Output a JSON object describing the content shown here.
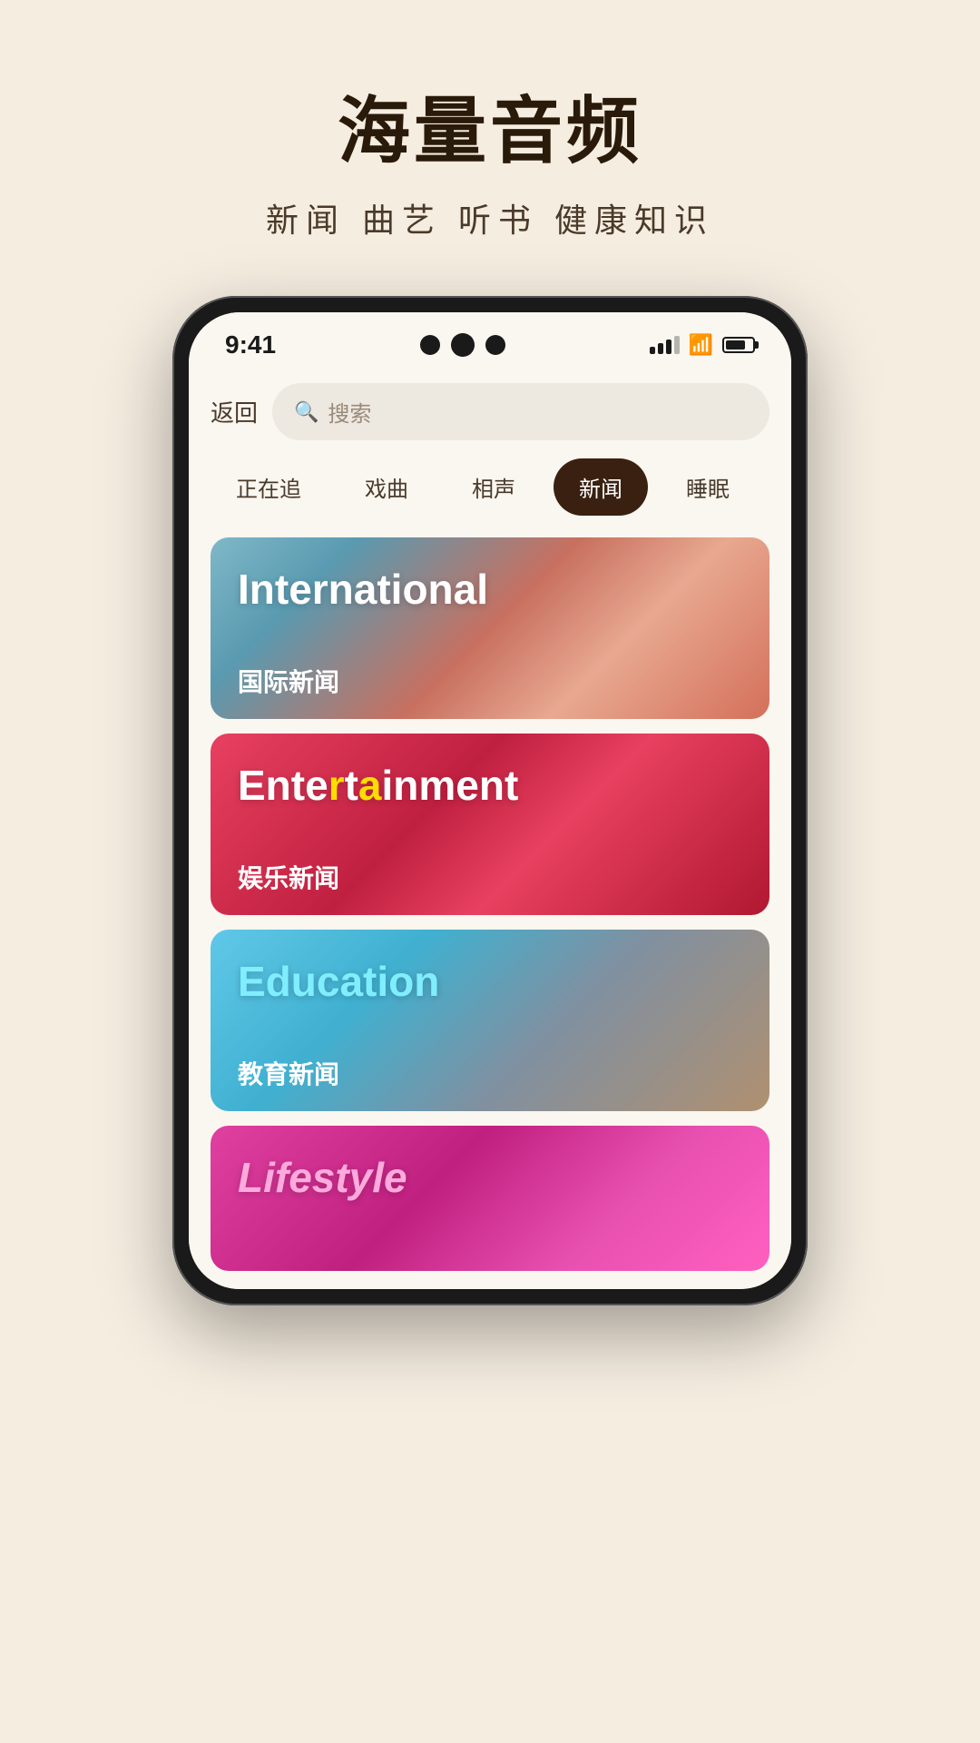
{
  "page": {
    "background_color": "#f5ede0",
    "title": "海量音频",
    "subtitle": "新闻 曲艺 听书 健康知识"
  },
  "status_bar": {
    "time": "9:41",
    "signal_strength": 3,
    "wifi": true,
    "battery_percent": 75
  },
  "nav": {
    "back_label": "返回",
    "search_placeholder": "搜索"
  },
  "tabs": [
    {
      "id": "following",
      "label": "正在追",
      "active": false
    },
    {
      "id": "opera",
      "label": "戏曲",
      "active": false
    },
    {
      "id": "crosstalk",
      "label": "相声",
      "active": false
    },
    {
      "id": "news",
      "label": "新闻",
      "active": true
    },
    {
      "id": "sleep",
      "label": "睡眠",
      "active": false
    }
  ],
  "cards": [
    {
      "id": "international",
      "title_en": "International",
      "title_cn": "国际新闻",
      "gradient_class": "card-international"
    },
    {
      "id": "entertainment",
      "title_en": "Entertainment",
      "title_cn": "娱乐新闻",
      "gradient_class": "card-entertainment"
    },
    {
      "id": "education",
      "title_en": "Education",
      "title_cn": "教育新闻",
      "gradient_class": "card-education"
    },
    {
      "id": "lifestyle",
      "title_en": "Lifestyle",
      "title_cn": "",
      "gradient_class": "card-lifestyle"
    }
  ]
}
